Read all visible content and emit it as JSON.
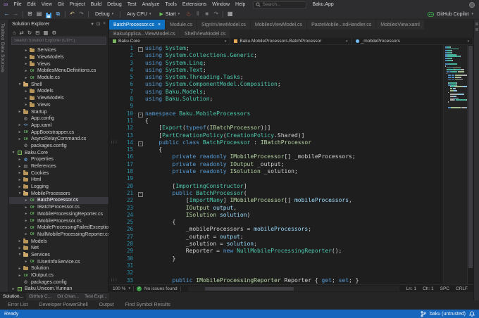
{
  "colors": {
    "accent": "#0e70c0",
    "status_bar": "#1666bd",
    "copilot_green": "#3fb950",
    "start_green": "#6cc25b"
  },
  "icons": {
    "vs_logo": "∞",
    "back": "←",
    "forward": "→",
    "new_file": "⊞",
    "open_file": "▤",
    "save_all": "⧉",
    "undo": "↶",
    "redo": "↷",
    "pause": "‖",
    "stop": "■",
    "hot_reload": "♨",
    "step_over": "↷",
    "play": "▶",
    "chevron_down": "▾",
    "home": "⌂",
    "sync": "⇄",
    "refresh": "↻",
    "collapse_all": "⊟",
    "show_all_files": "▦",
    "gear": "⚙",
    "pin": "⊡",
    "close": "×",
    "arrow_collapsed": "▸",
    "arrow_expanded": "▾",
    "cs_file": "C#",
    "xaml_tag": "<>",
    "refs": "▤",
    "codelens_marks": "|||",
    "fold": "-"
  },
  "menu_bar": {
    "menus": [
      "File",
      "Edit",
      "View",
      "Git",
      "Project",
      "Build",
      "Debug",
      "Test",
      "Analyze",
      "Tools",
      "Extensions",
      "Window",
      "Help"
    ],
    "search_placeholder": "Search...",
    "app_title": "Baku.App"
  },
  "toolbar": {
    "debug_config": "Debug",
    "platform": "Any CPU",
    "start_label": "Start",
    "copilot_label": "GitHub Copilot"
  },
  "activity_bar": {
    "tabs": [
      "Toolbox",
      "Data Sources"
    ]
  },
  "solution_explorer": {
    "title": "Solution Explorer",
    "search_placeholder": "Search Solution Explorer (Ctrl+;)",
    "tree": [
      {
        "d": 2,
        "i": "folder",
        "a": 0,
        "l": "Services"
      },
      {
        "d": 2,
        "i": "folder",
        "a": 0,
        "l": "ViewModels"
      },
      {
        "d": 2,
        "i": "folder",
        "a": 0,
        "l": "Views"
      },
      {
        "d": 2,
        "i": "cs",
        "a": 0,
        "l": "MobilesMenuDefinitions.cs"
      },
      {
        "d": 2,
        "i": "cs",
        "a": 0,
        "l": "Module.cs"
      },
      {
        "d": 1,
        "i": "folder-open",
        "a": 1,
        "l": "Shell"
      },
      {
        "d": 2,
        "i": "folder",
        "a": 0,
        "l": "Models"
      },
      {
        "d": 2,
        "i": "folder",
        "a": 0,
        "l": "ViewModels"
      },
      {
        "d": 2,
        "i": "folder",
        "a": 0,
        "l": "Views"
      },
      {
        "d": 1,
        "i": "folder",
        "a": 0,
        "l": "Startup"
      },
      {
        "d": 1,
        "i": "config",
        "a": -1,
        "l": "App.config"
      },
      {
        "d": 1,
        "i": "xaml",
        "a": 0,
        "l": "App.xaml"
      },
      {
        "d": 1,
        "i": "cs",
        "a": 0,
        "l": "AppBootstrapper.cs"
      },
      {
        "d": 1,
        "i": "cs",
        "a": 0,
        "l": "AsyncRelayCommand.cs"
      },
      {
        "d": 1,
        "i": "config",
        "a": -1,
        "l": "packages.config"
      },
      {
        "d": 0,
        "i": "project",
        "a": 1,
        "l": "Baku.Core"
      },
      {
        "d": 1,
        "i": "props",
        "a": 0,
        "l": "Properties"
      },
      {
        "d": 1,
        "i": "refs",
        "a": 0,
        "l": "References"
      },
      {
        "d": 1,
        "i": "folder",
        "a": 0,
        "l": "Cookies"
      },
      {
        "d": 1,
        "i": "folder",
        "a": 0,
        "l": "Html"
      },
      {
        "d": 1,
        "i": "folder",
        "a": 0,
        "l": "Logging"
      },
      {
        "d": 1,
        "i": "folder-open",
        "a": 1,
        "l": "MobileProcessors"
      },
      {
        "d": 2,
        "i": "cs",
        "a": 0,
        "l": "BatchProcessor.cs",
        "sel": true
      },
      {
        "d": 2,
        "i": "cs",
        "a": 0,
        "l": "IBatchProcessor.cs"
      },
      {
        "d": 2,
        "i": "cs",
        "a": 0,
        "l": "IMobileProcessingReporter.cs"
      },
      {
        "d": 2,
        "i": "cs",
        "a": 0,
        "l": "IMobileProcessor.cs"
      },
      {
        "d": 2,
        "i": "cs",
        "a": 0,
        "l": "MobileProcessingFailedException.cs"
      },
      {
        "d": 2,
        "i": "cs",
        "a": 0,
        "l": "NullMobileProcessingReporter.cs"
      },
      {
        "d": 1,
        "i": "folder",
        "a": 0,
        "l": "Models"
      },
      {
        "d": 1,
        "i": "folder",
        "a": 0,
        "l": "Net"
      },
      {
        "d": 1,
        "i": "folder-open",
        "a": 1,
        "l": "Services"
      },
      {
        "d": 2,
        "i": "cs",
        "a": 0,
        "l": "IUserInfoService.cs"
      },
      {
        "d": 1,
        "i": "folder",
        "a": 0,
        "l": "Solution"
      },
      {
        "d": 1,
        "i": "cs",
        "a": 0,
        "l": "IOutput.cs"
      },
      {
        "d": 1,
        "i": "config",
        "a": -1,
        "l": "packages.config"
      },
      {
        "d": 0,
        "i": "project",
        "a": 0,
        "l": "Baku.Unicom.Yunnan"
      }
    ]
  },
  "editor": {
    "tab_rows": [
      [
        {
          "label": "BatchProcessor.cs",
          "active": true
        },
        {
          "label": "Module.cs"
        },
        {
          "label": "SignInViewModel.cs"
        },
        {
          "label": "MobilesViewModel.cs"
        },
        {
          "label": "PasteMobile...ndHandler.cs"
        },
        {
          "label": "MobilesView.xaml"
        }
      ],
      [
        {
          "label": "BakuApplica...ViewModel.cs"
        },
        {
          "label": "ShellViewModel.cs"
        }
      ]
    ],
    "breadcrumbs": [
      {
        "label": "Baku.Core",
        "icon": "project-icon"
      },
      {
        "label": "Baku.MobileProcessors.BatchProcessor",
        "icon": "class-icon"
      },
      {
        "label": "_mobileProcessors",
        "icon": "field-icon"
      }
    ],
    "code": [
      {
        "n": 1,
        "f": 1,
        "t": [
          [
            "k",
            "using"
          ],
          [
            "pl",
            " "
          ],
          [
            "ns",
            "System"
          ],
          [
            "pl",
            ";"
          ]
        ]
      },
      {
        "n": 2,
        "t": [
          [
            "k",
            "using"
          ],
          [
            "pl",
            " "
          ],
          [
            "ns",
            "System.Collections.Generic"
          ],
          [
            "pl",
            ";"
          ]
        ]
      },
      {
        "n": 3,
        "t": [
          [
            "k",
            "using"
          ],
          [
            "pl",
            " "
          ],
          [
            "ns",
            "System.Linq"
          ],
          [
            "pl",
            ";"
          ]
        ]
      },
      {
        "n": 4,
        "t": [
          [
            "k",
            "using"
          ],
          [
            "pl",
            " "
          ],
          [
            "ns",
            "System.Text"
          ],
          [
            "pl",
            ";"
          ]
        ]
      },
      {
        "n": 5,
        "t": [
          [
            "k",
            "using"
          ],
          [
            "pl",
            " "
          ],
          [
            "ns",
            "System.Threading.Tasks"
          ],
          [
            "pl",
            ";"
          ]
        ]
      },
      {
        "n": 6,
        "t": [
          [
            "k",
            "using"
          ],
          [
            "pl",
            " "
          ],
          [
            "ns",
            "System.ComponentModel.Composition"
          ],
          [
            "pl",
            ";"
          ]
        ]
      },
      {
        "n": 7,
        "t": [
          [
            "k",
            "using"
          ],
          [
            "pl",
            " "
          ],
          [
            "ns",
            "Baku.Models"
          ],
          [
            "pl",
            ";"
          ]
        ]
      },
      {
        "n": 8,
        "t": [
          [
            "k",
            "using"
          ],
          [
            "pl",
            " "
          ],
          [
            "ns",
            "Baku.Solution"
          ],
          [
            "pl",
            ";"
          ]
        ]
      },
      {
        "n": 9,
        "t": []
      },
      {
        "n": 10,
        "f": 1,
        "t": [
          [
            "k",
            "namespace"
          ],
          [
            "pl",
            " "
          ],
          [
            "ns",
            "Baku.MobileProcessors"
          ]
        ]
      },
      {
        "n": 11,
        "t": [
          [
            "pl",
            "{"
          ]
        ]
      },
      {
        "n": 12,
        "t": [
          [
            "pl",
            "    ["
          ],
          [
            "t",
            "Export"
          ],
          [
            "pl",
            "("
          ],
          [
            "k",
            "typeof"
          ],
          [
            "pl",
            "("
          ],
          [
            "i",
            "IBatchProcessor"
          ],
          [
            "pl",
            "))]"
          ]
        ]
      },
      {
        "n": 13,
        "t": [
          [
            "pl",
            "    ["
          ],
          [
            "t",
            "PartCreationPolicy"
          ],
          [
            "pl",
            "("
          ],
          [
            "t",
            "CreationPolicy"
          ],
          [
            "pl",
            ".Shared)]"
          ]
        ]
      },
      {
        "n": 14,
        "f": 1,
        "m": 1,
        "t": [
          [
            "pl",
            "    "
          ],
          [
            "k",
            "public"
          ],
          [
            "pl",
            " "
          ],
          [
            "k",
            "class"
          ],
          [
            "pl",
            " "
          ],
          [
            "t",
            "BatchProcessor"
          ],
          [
            "pl",
            " : "
          ],
          [
            "i",
            "IBatchProcessor"
          ]
        ]
      },
      {
        "n": 15,
        "t": [
          [
            "pl",
            "    {"
          ]
        ]
      },
      {
        "n": 16,
        "t": [
          [
            "pl",
            "        "
          ],
          [
            "k",
            "private"
          ],
          [
            "pl",
            " "
          ],
          [
            "k",
            "readonly"
          ],
          [
            "pl",
            " "
          ],
          [
            "i",
            "IMobileProcessor"
          ],
          [
            "pl",
            "[] _mobileProcessors;"
          ]
        ]
      },
      {
        "n": 17,
        "t": [
          [
            "pl",
            "        "
          ],
          [
            "k",
            "private"
          ],
          [
            "pl",
            " "
          ],
          [
            "k",
            "readonly"
          ],
          [
            "pl",
            " "
          ],
          [
            "i",
            "IOutput"
          ],
          [
            "pl",
            " _output;"
          ]
        ]
      },
      {
        "n": 18,
        "t": [
          [
            "pl",
            "        "
          ],
          [
            "k",
            "private"
          ],
          [
            "pl",
            " "
          ],
          [
            "k",
            "readonly"
          ],
          [
            "pl",
            " "
          ],
          [
            "i",
            "ISolution"
          ],
          [
            "pl",
            " _solution;"
          ]
        ]
      },
      {
        "n": 19,
        "t": []
      },
      {
        "n": 20,
        "t": [
          [
            "pl",
            "        ["
          ],
          [
            "t",
            "ImportingConstructor"
          ],
          [
            "pl",
            "]"
          ]
        ]
      },
      {
        "n": 21,
        "f": 1,
        "t": [
          [
            "pl",
            "        "
          ],
          [
            "k",
            "public"
          ],
          [
            "pl",
            " "
          ],
          [
            "t",
            "BatchProcessor"
          ],
          [
            "pl",
            "("
          ]
        ]
      },
      {
        "n": 22,
        "t": [
          [
            "pl",
            "            ["
          ],
          [
            "t",
            "ImportMany"
          ],
          [
            "pl",
            "] "
          ],
          [
            "i",
            "IMobileProcessor"
          ],
          [
            "pl",
            "[] "
          ],
          [
            "v",
            "mobileProcessors"
          ],
          [
            "pl",
            ","
          ]
        ]
      },
      {
        "n": 23,
        "t": [
          [
            "pl",
            "            "
          ],
          [
            "i",
            "IOutput"
          ],
          [
            "pl",
            " "
          ],
          [
            "v",
            "output"
          ],
          [
            "pl",
            ","
          ]
        ]
      },
      {
        "n": 24,
        "t": [
          [
            "pl",
            "            "
          ],
          [
            "i",
            "ISolution"
          ],
          [
            "pl",
            " "
          ],
          [
            "v",
            "solution"
          ],
          [
            "pl",
            ")"
          ]
        ]
      },
      {
        "n": 25,
        "t": [
          [
            "pl",
            "        {"
          ]
        ]
      },
      {
        "n": 26,
        "t": [
          [
            "pl",
            "            _mobileProcessors = "
          ],
          [
            "v",
            "mobileProcessors"
          ],
          [
            "pl",
            ";"
          ]
        ]
      },
      {
        "n": 27,
        "t": [
          [
            "pl",
            "            _output = "
          ],
          [
            "v",
            "output"
          ],
          [
            "pl",
            ";"
          ]
        ]
      },
      {
        "n": 28,
        "t": [
          [
            "pl",
            "            _solution = "
          ],
          [
            "v",
            "solution"
          ],
          [
            "pl",
            ";"
          ]
        ]
      },
      {
        "n": 29,
        "t": [
          [
            "pl",
            "            Reporter = "
          ],
          [
            "k",
            "new"
          ],
          [
            "pl",
            " "
          ],
          [
            "t",
            "NullMobileProcessingReporter"
          ],
          [
            "pl",
            "();"
          ]
        ]
      },
      {
        "n": 30,
        "t": [
          [
            "pl",
            "        }"
          ]
        ]
      },
      {
        "n": 31,
        "t": []
      },
      {
        "n": 32,
        "t": []
      },
      {
        "n": 33,
        "m": 1,
        "t": [
          [
            "pl",
            "        "
          ],
          [
            "k",
            "public"
          ],
          [
            "pl",
            " "
          ],
          [
            "i",
            "IMobileProcessingReporter"
          ],
          [
            "pl",
            " Reporter { "
          ],
          [
            "k",
            "get"
          ],
          [
            "pl",
            "; "
          ],
          [
            "k",
            "set"
          ],
          [
            "pl",
            "; }"
          ]
        ]
      }
    ],
    "status": {
      "zoom": "100 %",
      "issues": "No issues found",
      "ln": "Ln: 1",
      "ch": "Ch: 1",
      "enc": "SPC",
      "eol": "CRLF"
    }
  },
  "sidebar_tabs": [
    {
      "label": "Solution...",
      "active": true
    },
    {
      "label": "GitHub C..."
    },
    {
      "label": "Git Chan..."
    },
    {
      "label": "Test Expl..."
    }
  ],
  "panel_tabs": [
    "Error List",
    "Developer PowerShell",
    "Output",
    "Find Symbol Results"
  ],
  "status_bar": {
    "message": "Ready",
    "repo": "baku (untrusted)"
  }
}
